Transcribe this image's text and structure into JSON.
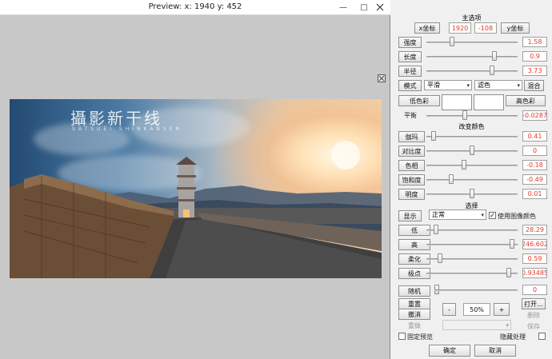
{
  "preview": {
    "title": "Preview:  x: 1940 y: 452",
    "minimize": "—",
    "maximize": "□",
    "watermark_title": "攝影新干线",
    "watermark_sub": "SATSUEI SHINKANSEN",
    "watermark_ghost": "新干线"
  },
  "panel": {
    "main_title": "主选项",
    "x_coord_button": "x坐标",
    "x_coord_value": "1920",
    "y_coord_value": "-108",
    "y_coord_button": "y坐标",
    "sliders_top": [
      {
        "label": "强度",
        "value": "1.58",
        "pos": 0.27
      },
      {
        "label": "长度",
        "value": "0.9",
        "pos": 0.76
      },
      {
        "label": "半径",
        "value": "3.73",
        "pos": 0.73
      }
    ],
    "mode_label": "模式",
    "mode_value": "平滑",
    "blend_value": "滤色",
    "mix_button": "混合",
    "low_color_label": "低色彩",
    "high_color_label": "高色彩",
    "balance_label": "平衡",
    "balance_value": "-0.0287",
    "balance_pos": 0.42,
    "adjust_title": "改变颜色",
    "sliders_color": [
      {
        "label": "伽玛",
        "value": "0.41",
        "pos": 0.06
      },
      {
        "label": "对比度",
        "value": "0",
        "pos": 0.5
      },
      {
        "label": "色相",
        "value": "-0.18",
        "pos": 0.41
      },
      {
        "label": "饱和度",
        "value": "-0.49",
        "pos": 0.26
      },
      {
        "label": "明度",
        "value": "0.01",
        "pos": 0.5
      }
    ],
    "select_title": "选择",
    "show_label": "显示",
    "show_value": "正常",
    "use_image_color": "使用图像颜色",
    "sliders_select": [
      {
        "label": "低",
        "value": "28.29",
        "pos": 0.08
      },
      {
        "label": "高",
        "value": "246.602",
        "pos": 0.96
      },
      {
        "label": "柔化",
        "value": "0.59",
        "pos": 0.13
      },
      {
        "label": "极点",
        "value": "0.93485",
        "pos": 0.93
      }
    ],
    "random_button": "随机",
    "random_value": "0",
    "reset_button": "重置",
    "undo_button": "撤消",
    "redo_button": "重做",
    "zoom_out": "-",
    "zoom_value": "50%",
    "zoom_in": "+",
    "open_button": "打开...",
    "delete_button": "删除",
    "save_button": "保存",
    "fixed_preview": "固定预览",
    "hide_processing": "隐藏处理",
    "ok_button": "确定",
    "cancel_button": "取消"
  }
}
